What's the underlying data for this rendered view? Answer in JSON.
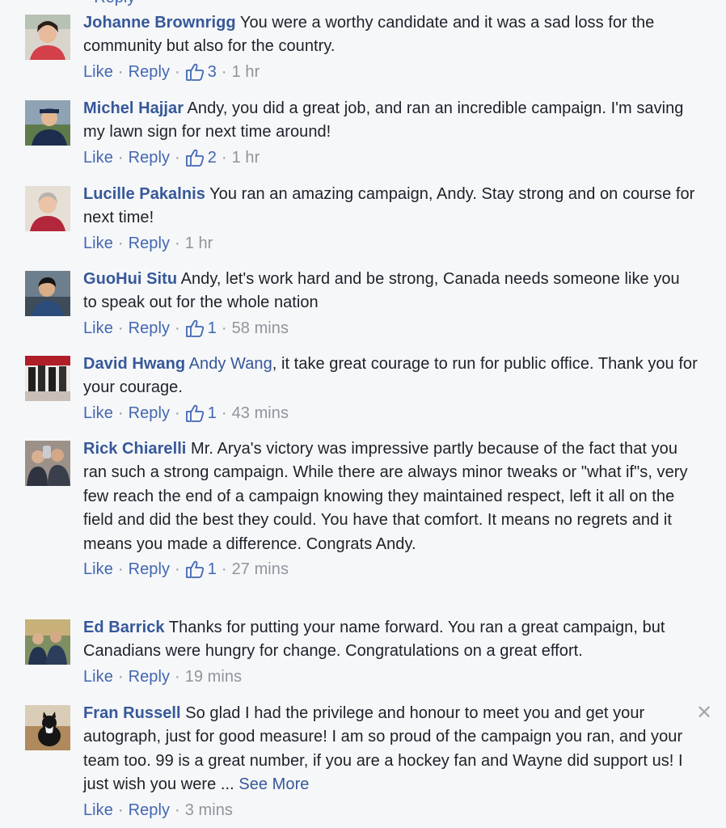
{
  "comments": [
    {
      "author": "Johanne Brownrigg",
      "text": "You were a worthy candidate and it was a sad loss for the community but also for the country.",
      "like_label": "Like",
      "reply_label": "Reply",
      "likes": "3",
      "time": "1 hr"
    },
    {
      "author": "Michel Hajjar",
      "text": "Andy, you did a great job, and ran an incredible campaign. I'm saving my lawn sign for next time around!",
      "like_label": "Like",
      "reply_label": "Reply",
      "likes": "2",
      "time": "1 hr"
    },
    {
      "author": "Lucille Pakalnis",
      "text": "You ran an amazing campaign, Andy. Stay strong and on course for next time!",
      "like_label": "Like",
      "reply_label": "Reply",
      "time": "1 hr"
    },
    {
      "author": "GuoHui Situ",
      "text": "Andy, let's work hard and be strong, Canada needs someone like you to speak out for the whole nation",
      "like_label": "Like",
      "reply_label": "Reply",
      "likes": "1",
      "time": "58 mins"
    },
    {
      "author": "David Hwang",
      "mention": "Andy Wang",
      "text": ", it take great courage to run for public office. Thank you for your courage.",
      "like_label": "Like",
      "reply_label": "Reply",
      "likes": "1",
      "time": "43 mins"
    },
    {
      "author": "Rick Chiarelli",
      "text": "Mr. Arya's victory was impressive partly because of the fact that you ran such a strong campaign. While there are always minor tweaks or \"what if\"s, very few reach the end of a campaign knowing they maintained respect, left it all on the field and did the best they could. You have that comfort. It means no regrets and it means you made a difference. Congrats Andy.",
      "like_label": "Like",
      "reply_label": "Reply",
      "likes": "1",
      "time": "27 mins"
    },
    {
      "author": "Ed Barrick",
      "text": "Thanks for putting your name forward. You ran a great campaign, but Canadians were hungry for change. Congratulations on a great effort.",
      "like_label": "Like",
      "reply_label": "Reply",
      "time": "19 mins"
    },
    {
      "author": "Fran Russell",
      "text": "So glad I had the privilege and honour to meet you and get your autograph, just for good measure! I am so proud of the campaign you ran, and your team too. 99 is a great number, if you are a hockey fan and Wayne did support us! I just wish you were ...",
      "see_more": "See More",
      "like_label": "Like",
      "reply_label": "Reply",
      "time": "3 mins"
    }
  ],
  "colors": {
    "link": "#365899",
    "action": "#4267b2",
    "meta": "#90949c",
    "text": "#1d2129",
    "background": "#f6f7f9"
  },
  "icons": {
    "like_count": "thumbs-up-icon",
    "dismiss": "close-icon"
  }
}
